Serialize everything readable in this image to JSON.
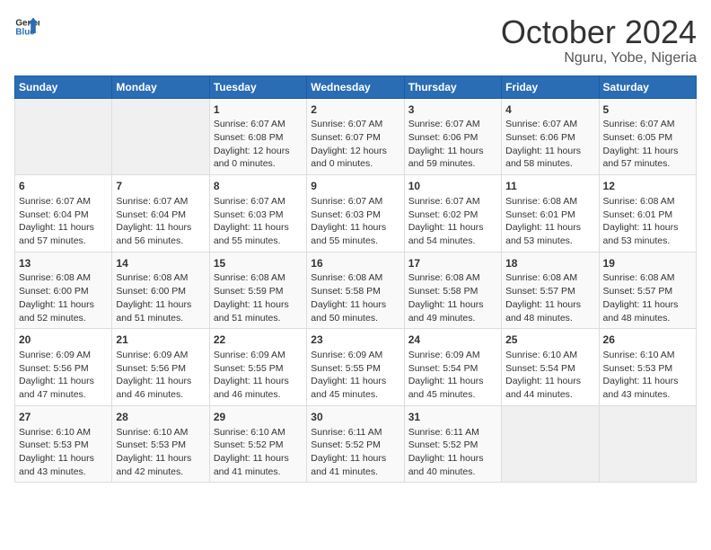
{
  "header": {
    "logo_line1": "General",
    "logo_line2": "Blue",
    "month_year": "October 2024",
    "location": "Nguru, Yobe, Nigeria"
  },
  "weekdays": [
    "Sunday",
    "Monday",
    "Tuesday",
    "Wednesday",
    "Thursday",
    "Friday",
    "Saturday"
  ],
  "weeks": [
    [
      {
        "day": "",
        "sunrise": "",
        "sunset": "",
        "daylight": "",
        "empty": true
      },
      {
        "day": "",
        "sunrise": "",
        "sunset": "",
        "daylight": "",
        "empty": true
      },
      {
        "day": "1",
        "sunrise": "Sunrise: 6:07 AM",
        "sunset": "Sunset: 6:08 PM",
        "daylight": "Daylight: 12 hours and 0 minutes."
      },
      {
        "day": "2",
        "sunrise": "Sunrise: 6:07 AM",
        "sunset": "Sunset: 6:07 PM",
        "daylight": "Daylight: 12 hours and 0 minutes."
      },
      {
        "day": "3",
        "sunrise": "Sunrise: 6:07 AM",
        "sunset": "Sunset: 6:06 PM",
        "daylight": "Daylight: 11 hours and 59 minutes."
      },
      {
        "day": "4",
        "sunrise": "Sunrise: 6:07 AM",
        "sunset": "Sunset: 6:06 PM",
        "daylight": "Daylight: 11 hours and 58 minutes."
      },
      {
        "day": "5",
        "sunrise": "Sunrise: 6:07 AM",
        "sunset": "Sunset: 6:05 PM",
        "daylight": "Daylight: 11 hours and 57 minutes."
      }
    ],
    [
      {
        "day": "6",
        "sunrise": "Sunrise: 6:07 AM",
        "sunset": "Sunset: 6:04 PM",
        "daylight": "Daylight: 11 hours and 57 minutes."
      },
      {
        "day": "7",
        "sunrise": "Sunrise: 6:07 AM",
        "sunset": "Sunset: 6:04 PM",
        "daylight": "Daylight: 11 hours and 56 minutes."
      },
      {
        "day": "8",
        "sunrise": "Sunrise: 6:07 AM",
        "sunset": "Sunset: 6:03 PM",
        "daylight": "Daylight: 11 hours and 55 minutes."
      },
      {
        "day": "9",
        "sunrise": "Sunrise: 6:07 AM",
        "sunset": "Sunset: 6:03 PM",
        "daylight": "Daylight: 11 hours and 55 minutes."
      },
      {
        "day": "10",
        "sunrise": "Sunrise: 6:07 AM",
        "sunset": "Sunset: 6:02 PM",
        "daylight": "Daylight: 11 hours and 54 minutes."
      },
      {
        "day": "11",
        "sunrise": "Sunrise: 6:08 AM",
        "sunset": "Sunset: 6:01 PM",
        "daylight": "Daylight: 11 hours and 53 minutes."
      },
      {
        "day": "12",
        "sunrise": "Sunrise: 6:08 AM",
        "sunset": "Sunset: 6:01 PM",
        "daylight": "Daylight: 11 hours and 53 minutes."
      }
    ],
    [
      {
        "day": "13",
        "sunrise": "Sunrise: 6:08 AM",
        "sunset": "Sunset: 6:00 PM",
        "daylight": "Daylight: 11 hours and 52 minutes."
      },
      {
        "day": "14",
        "sunrise": "Sunrise: 6:08 AM",
        "sunset": "Sunset: 6:00 PM",
        "daylight": "Daylight: 11 hours and 51 minutes."
      },
      {
        "day": "15",
        "sunrise": "Sunrise: 6:08 AM",
        "sunset": "Sunset: 5:59 PM",
        "daylight": "Daylight: 11 hours and 51 minutes."
      },
      {
        "day": "16",
        "sunrise": "Sunrise: 6:08 AM",
        "sunset": "Sunset: 5:58 PM",
        "daylight": "Daylight: 11 hours and 50 minutes."
      },
      {
        "day": "17",
        "sunrise": "Sunrise: 6:08 AM",
        "sunset": "Sunset: 5:58 PM",
        "daylight": "Daylight: 11 hours and 49 minutes."
      },
      {
        "day": "18",
        "sunrise": "Sunrise: 6:08 AM",
        "sunset": "Sunset: 5:57 PM",
        "daylight": "Daylight: 11 hours and 48 minutes."
      },
      {
        "day": "19",
        "sunrise": "Sunrise: 6:08 AM",
        "sunset": "Sunset: 5:57 PM",
        "daylight": "Daylight: 11 hours and 48 minutes."
      }
    ],
    [
      {
        "day": "20",
        "sunrise": "Sunrise: 6:09 AM",
        "sunset": "Sunset: 5:56 PM",
        "daylight": "Daylight: 11 hours and 47 minutes."
      },
      {
        "day": "21",
        "sunrise": "Sunrise: 6:09 AM",
        "sunset": "Sunset: 5:56 PM",
        "daylight": "Daylight: 11 hours and 46 minutes."
      },
      {
        "day": "22",
        "sunrise": "Sunrise: 6:09 AM",
        "sunset": "Sunset: 5:55 PM",
        "daylight": "Daylight: 11 hours and 46 minutes."
      },
      {
        "day": "23",
        "sunrise": "Sunrise: 6:09 AM",
        "sunset": "Sunset: 5:55 PM",
        "daylight": "Daylight: 11 hours and 45 minutes."
      },
      {
        "day": "24",
        "sunrise": "Sunrise: 6:09 AM",
        "sunset": "Sunset: 5:54 PM",
        "daylight": "Daylight: 11 hours and 45 minutes."
      },
      {
        "day": "25",
        "sunrise": "Sunrise: 6:10 AM",
        "sunset": "Sunset: 5:54 PM",
        "daylight": "Daylight: 11 hours and 44 minutes."
      },
      {
        "day": "26",
        "sunrise": "Sunrise: 6:10 AM",
        "sunset": "Sunset: 5:53 PM",
        "daylight": "Daylight: 11 hours and 43 minutes."
      }
    ],
    [
      {
        "day": "27",
        "sunrise": "Sunrise: 6:10 AM",
        "sunset": "Sunset: 5:53 PM",
        "daylight": "Daylight: 11 hours and 43 minutes."
      },
      {
        "day": "28",
        "sunrise": "Sunrise: 6:10 AM",
        "sunset": "Sunset: 5:53 PM",
        "daylight": "Daylight: 11 hours and 42 minutes."
      },
      {
        "day": "29",
        "sunrise": "Sunrise: 6:10 AM",
        "sunset": "Sunset: 5:52 PM",
        "daylight": "Daylight: 11 hours and 41 minutes."
      },
      {
        "day": "30",
        "sunrise": "Sunrise: 6:11 AM",
        "sunset": "Sunset: 5:52 PM",
        "daylight": "Daylight: 11 hours and 41 minutes."
      },
      {
        "day": "31",
        "sunrise": "Sunrise: 6:11 AM",
        "sunset": "Sunset: 5:52 PM",
        "daylight": "Daylight: 11 hours and 40 minutes."
      },
      {
        "day": "",
        "sunrise": "",
        "sunset": "",
        "daylight": "",
        "empty": true
      },
      {
        "day": "",
        "sunrise": "",
        "sunset": "",
        "daylight": "",
        "empty": true
      }
    ]
  ]
}
